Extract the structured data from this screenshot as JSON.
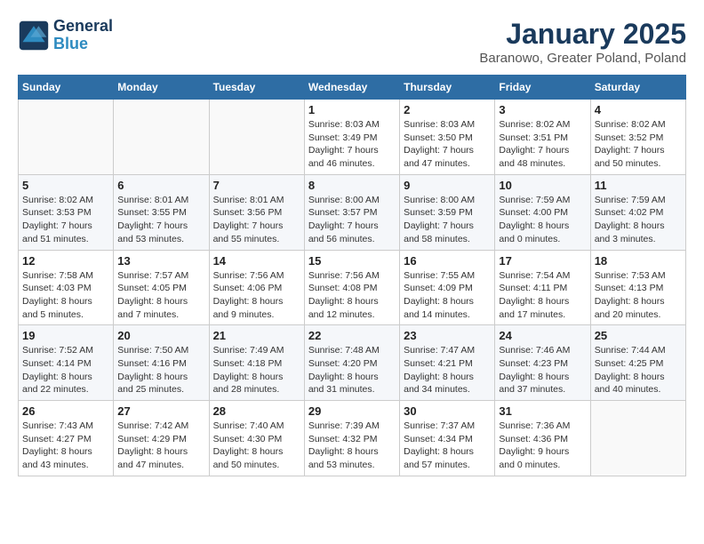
{
  "logo": {
    "line1": "General",
    "line2": "Blue"
  },
  "title": "January 2025",
  "subtitle": "Baranowo, Greater Poland, Poland",
  "weekdays": [
    "Sunday",
    "Monday",
    "Tuesday",
    "Wednesday",
    "Thursday",
    "Friday",
    "Saturday"
  ],
  "weeks": [
    [
      {
        "day": "",
        "info": ""
      },
      {
        "day": "",
        "info": ""
      },
      {
        "day": "",
        "info": ""
      },
      {
        "day": "1",
        "info": "Sunrise: 8:03 AM\nSunset: 3:49 PM\nDaylight: 7 hours and 46 minutes."
      },
      {
        "day": "2",
        "info": "Sunrise: 8:03 AM\nSunset: 3:50 PM\nDaylight: 7 hours and 47 minutes."
      },
      {
        "day": "3",
        "info": "Sunrise: 8:02 AM\nSunset: 3:51 PM\nDaylight: 7 hours and 48 minutes."
      },
      {
        "day": "4",
        "info": "Sunrise: 8:02 AM\nSunset: 3:52 PM\nDaylight: 7 hours and 50 minutes."
      }
    ],
    [
      {
        "day": "5",
        "info": "Sunrise: 8:02 AM\nSunset: 3:53 PM\nDaylight: 7 hours and 51 minutes."
      },
      {
        "day": "6",
        "info": "Sunrise: 8:01 AM\nSunset: 3:55 PM\nDaylight: 7 hours and 53 minutes."
      },
      {
        "day": "7",
        "info": "Sunrise: 8:01 AM\nSunset: 3:56 PM\nDaylight: 7 hours and 55 minutes."
      },
      {
        "day": "8",
        "info": "Sunrise: 8:00 AM\nSunset: 3:57 PM\nDaylight: 7 hours and 56 minutes."
      },
      {
        "day": "9",
        "info": "Sunrise: 8:00 AM\nSunset: 3:59 PM\nDaylight: 7 hours and 58 minutes."
      },
      {
        "day": "10",
        "info": "Sunrise: 7:59 AM\nSunset: 4:00 PM\nDaylight: 8 hours and 0 minutes."
      },
      {
        "day": "11",
        "info": "Sunrise: 7:59 AM\nSunset: 4:02 PM\nDaylight: 8 hours and 3 minutes."
      }
    ],
    [
      {
        "day": "12",
        "info": "Sunrise: 7:58 AM\nSunset: 4:03 PM\nDaylight: 8 hours and 5 minutes."
      },
      {
        "day": "13",
        "info": "Sunrise: 7:57 AM\nSunset: 4:05 PM\nDaylight: 8 hours and 7 minutes."
      },
      {
        "day": "14",
        "info": "Sunrise: 7:56 AM\nSunset: 4:06 PM\nDaylight: 8 hours and 9 minutes."
      },
      {
        "day": "15",
        "info": "Sunrise: 7:56 AM\nSunset: 4:08 PM\nDaylight: 8 hours and 12 minutes."
      },
      {
        "day": "16",
        "info": "Sunrise: 7:55 AM\nSunset: 4:09 PM\nDaylight: 8 hours and 14 minutes."
      },
      {
        "day": "17",
        "info": "Sunrise: 7:54 AM\nSunset: 4:11 PM\nDaylight: 8 hours and 17 minutes."
      },
      {
        "day": "18",
        "info": "Sunrise: 7:53 AM\nSunset: 4:13 PM\nDaylight: 8 hours and 20 minutes."
      }
    ],
    [
      {
        "day": "19",
        "info": "Sunrise: 7:52 AM\nSunset: 4:14 PM\nDaylight: 8 hours and 22 minutes."
      },
      {
        "day": "20",
        "info": "Sunrise: 7:50 AM\nSunset: 4:16 PM\nDaylight: 8 hours and 25 minutes."
      },
      {
        "day": "21",
        "info": "Sunrise: 7:49 AM\nSunset: 4:18 PM\nDaylight: 8 hours and 28 minutes."
      },
      {
        "day": "22",
        "info": "Sunrise: 7:48 AM\nSunset: 4:20 PM\nDaylight: 8 hours and 31 minutes."
      },
      {
        "day": "23",
        "info": "Sunrise: 7:47 AM\nSunset: 4:21 PM\nDaylight: 8 hours and 34 minutes."
      },
      {
        "day": "24",
        "info": "Sunrise: 7:46 AM\nSunset: 4:23 PM\nDaylight: 8 hours and 37 minutes."
      },
      {
        "day": "25",
        "info": "Sunrise: 7:44 AM\nSunset: 4:25 PM\nDaylight: 8 hours and 40 minutes."
      }
    ],
    [
      {
        "day": "26",
        "info": "Sunrise: 7:43 AM\nSunset: 4:27 PM\nDaylight: 8 hours and 43 minutes."
      },
      {
        "day": "27",
        "info": "Sunrise: 7:42 AM\nSunset: 4:29 PM\nDaylight: 8 hours and 47 minutes."
      },
      {
        "day": "28",
        "info": "Sunrise: 7:40 AM\nSunset: 4:30 PM\nDaylight: 8 hours and 50 minutes."
      },
      {
        "day": "29",
        "info": "Sunrise: 7:39 AM\nSunset: 4:32 PM\nDaylight: 8 hours and 53 minutes."
      },
      {
        "day": "30",
        "info": "Sunrise: 7:37 AM\nSunset: 4:34 PM\nDaylight: 8 hours and 57 minutes."
      },
      {
        "day": "31",
        "info": "Sunrise: 7:36 AM\nSunset: 4:36 PM\nDaylight: 9 hours and 0 minutes."
      },
      {
        "day": "",
        "info": ""
      }
    ]
  ]
}
